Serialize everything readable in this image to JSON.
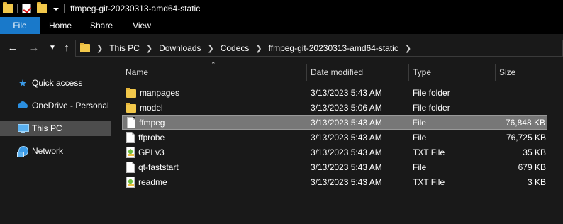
{
  "window": {
    "title": "ffmpeg-git-20230313-amd64-static"
  },
  "ribbon": {
    "tabs": [
      {
        "label": "File",
        "active": true
      },
      {
        "label": "Home"
      },
      {
        "label": "Share"
      },
      {
        "label": "View"
      }
    ]
  },
  "address": {
    "breadcrumbs": [
      "This PC",
      "Downloads",
      "Codecs",
      "ffmpeg-git-20230313-amd64-static"
    ]
  },
  "navpane": {
    "items": [
      {
        "label": "Quick access",
        "icon": "star-icon"
      },
      {
        "label": "OneDrive - Personal",
        "icon": "cloud-icon"
      },
      {
        "label": "This PC",
        "icon": "pc-icon",
        "selected": true
      },
      {
        "label": "Network",
        "icon": "network-icon"
      }
    ]
  },
  "columns": {
    "name": "Name",
    "date": "Date modified",
    "type": "Type",
    "size": "Size"
  },
  "files": [
    {
      "name": "manpages",
      "date": "3/13/2023 5:43 AM",
      "type": "File folder",
      "size": "",
      "icon": "folder-icon"
    },
    {
      "name": "model",
      "date": "3/13/2023 5:06 AM",
      "type": "File folder",
      "size": "",
      "icon": "folder-icon"
    },
    {
      "name": "ffmpeg",
      "date": "3/13/2023 5:43 AM",
      "type": "File",
      "size": "76,848 KB",
      "icon": "file-icon",
      "selected": true
    },
    {
      "name": "ffprobe",
      "date": "3/13/2023 5:43 AM",
      "type": "File",
      "size": "76,725 KB",
      "icon": "file-icon"
    },
    {
      "name": "GPLv3",
      "date": "3/13/2023 5:43 AM",
      "type": "TXT File",
      "size": "35 KB",
      "icon": "txt-icon"
    },
    {
      "name": "qt-faststart",
      "date": "3/13/2023 5:43 AM",
      "type": "File",
      "size": "679 KB",
      "icon": "file-icon"
    },
    {
      "name": "readme",
      "date": "3/13/2023 5:43 AM",
      "type": "TXT File",
      "size": "3 KB",
      "icon": "txt-icon"
    }
  ],
  "colors": {
    "accent": "#1979ca",
    "selected_row": "#777777",
    "folder": "#f2c84b"
  }
}
